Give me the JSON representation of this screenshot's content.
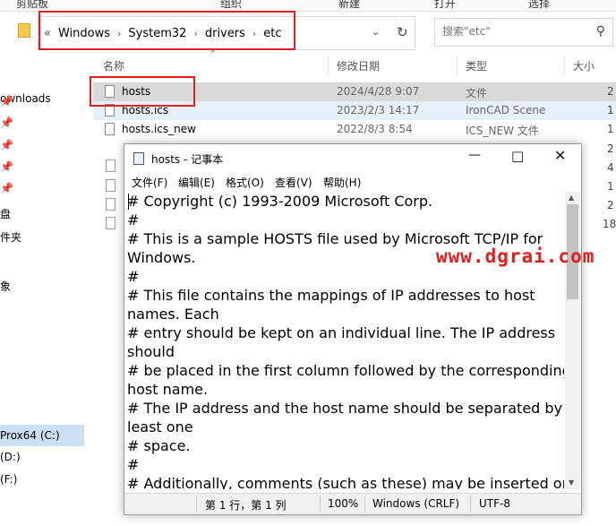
{
  "ribbon": {
    "clipboard": "剪贴板",
    "organize": "组织",
    "new": "新建",
    "open": "打开",
    "select": "选择"
  },
  "address": {
    "path": [
      "Windows",
      "System32",
      "drivers",
      "etc"
    ],
    "overflow": "«",
    "separator": "›"
  },
  "search": {
    "placeholder": "搜索\"etc\""
  },
  "nav": {
    "items": [
      "ownloads",
      "盘",
      "件夹",
      "象"
    ],
    "drives": [
      "Prox64 (C:)",
      "(D:)",
      "(F:)"
    ]
  },
  "columns": {
    "name": "名称",
    "modified": "修改日期",
    "type": "类型",
    "size": "大小"
  },
  "files": [
    {
      "name": "hosts",
      "date": "2024/4/28 9:07",
      "type": "文件",
      "size": "2"
    },
    {
      "name": "hosts.ics",
      "date": "2023/2/3 14:17",
      "type": "IronCAD Scene",
      "size": "1"
    },
    {
      "name": "hosts.ics_new",
      "date": "2022/8/3 8:54",
      "type": "ICS_NEW 文件",
      "size": "1"
    }
  ],
  "size_peek": [
    "2",
    "4",
    "1",
    "2",
    "18"
  ],
  "notepad": {
    "title": "hosts - 记事本",
    "menu": [
      "文件(F)",
      "编辑(E)",
      "格式(O)",
      "查看(V)",
      "帮助(H)"
    ],
    "lines": [
      "# Copyright (c) 1993-2009 Microsoft Corp.",
      "#",
      "# This is a sample HOSTS file used by Microsoft TCP/IP for",
      "Windows.",
      "#",
      "# This file contains the mappings of IP addresses to host",
      "names. Each",
      "# entry should be kept on an individual line. The IP address",
      "should",
      "# be placed in the first column followed by the corresponding",
      "host name.",
      "# The IP address and the host name should be separated by at",
      "least one",
      "# space.",
      "#",
      "# Additionally, comments (such as these) may be inserted on"
    ],
    "status": {
      "position": "第 1 行，第 1 列",
      "zoom": "100%",
      "eol": "Windows (CRLF)",
      "encoding": "UTF-8"
    }
  },
  "watermark": "www.dgrai.com",
  "colors": {
    "highlight_box": "#e02020",
    "selection": "#cce0f5",
    "watermark": "#e01e1e"
  }
}
